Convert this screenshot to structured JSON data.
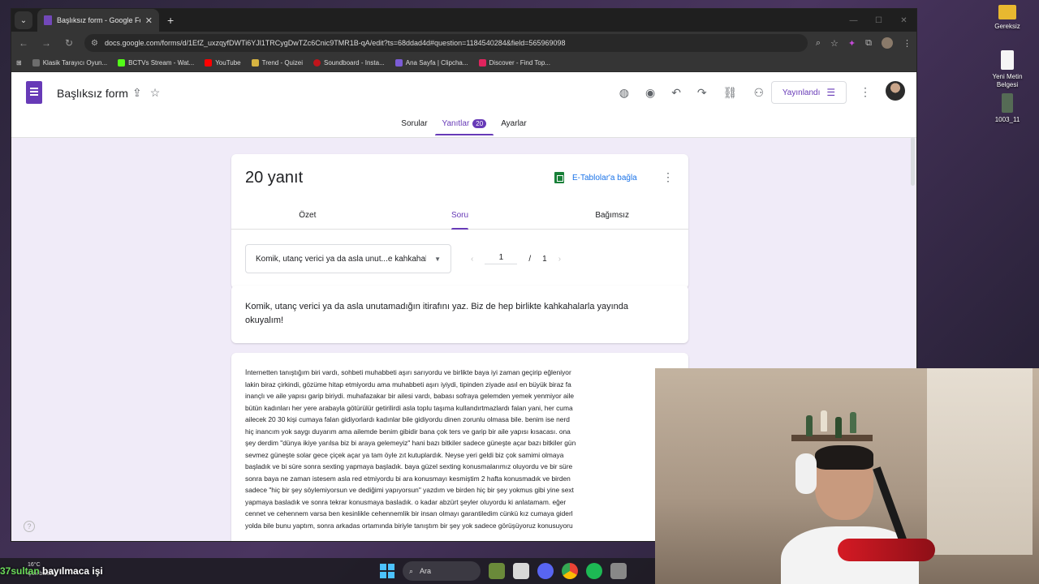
{
  "browser": {
    "tab_title": "Başlıksız form - Google Formlar",
    "url": "docs.google.com/forms/d/1EfZ_uxzqyfDWTi6YJl1TRCygDwTZc6Cnic9TMR1B-qA/edit?ts=68ddad4d#question=1184540284&field=565969098",
    "bookmarks": [
      {
        "label": "Klasik Tarayıcı Oyun...",
        "color": "#6d6d6d"
      },
      {
        "label": "BCTVs Stream - Wat...",
        "color": "#53fc18"
      },
      {
        "label": "YouTube",
        "color": "#ff0000"
      },
      {
        "label": "Trend - Quizei",
        "color": "#d6b341"
      },
      {
        "label": "Soundboard - Insta...",
        "color": "#c0141b"
      },
      {
        "label": "Ana Sayfa | Clipcha...",
        "color": "#7b5cd6"
      },
      {
        "label": "Discover - Find Top...",
        "color": "#e0245e"
      }
    ]
  },
  "form": {
    "title": "Başlıksız form",
    "publish_label": "Yayınlandı",
    "tabs": [
      {
        "label": "Sorular",
        "active": false
      },
      {
        "label": "Yanıtlar",
        "active": true,
        "badge": "20"
      },
      {
        "label": "Ayarlar",
        "active": false
      }
    ]
  },
  "responses": {
    "count_label": "20 yanıt",
    "sheets_link": "E-Tablolar'a bağla",
    "sub_tabs": [
      {
        "label": "Özet",
        "active": false
      },
      {
        "label": "Soru",
        "active": true
      },
      {
        "label": "Bağımsız",
        "active": false
      }
    ],
    "question_select": "Komik, utanç verici ya da asla unut...e kahkahalarla yayında okuyalım!",
    "pager": {
      "current": "1",
      "separator": "/",
      "total": "1"
    }
  },
  "question": {
    "text": "Komik, utanç verici ya da asla unutamadığın itirafını yaz. Biz de hep birlikte kahkahalarla yayında okuyalım!"
  },
  "answer": {
    "lines": [
      "İnternetten tanıştığım biri vardı, sohbeti muhabbeti aşırı sarıyordu ve birlikte baya iyi zaman geçirip eğleniyor",
      "lakin biraz çirkindi, gözüme hitap etmiyordu ama muhabbeti aşırı iyiydi, tipinden ziyade asıl en büyük biraz fa",
      "inançlı ve aile yapısı garip biriydi. muhafazakar bir ailesi vardı, babası sofraya gelemden yemek yenmiyor aile",
      "bütün kadınları her yere arabayla götürülür getirilirdi asla toplu taşıma kullandırtmazlardı falan yani, her cuma",
      "ailecek 20 30 kişi cumaya falan gidiyorlardı kadınlar bile gidiyordu dinen zorunlu olmasa bile. benim ise nerd",
      "hiç inancım yok saygı duyarım ama ailemde benim gibidir bana çok ters ve garip bir aile yapısı kısacası. ona",
      "şey derdim \"dünya ikiye yarılsa biz bi araya gelemeyiz\" hani bazı bitkiler sadece güneşte açar bazı bitkiler gün",
      "sevmez güneşte solar gece çiçek açar ya tam öyle zıt kutuplardık. Neyse yeri geldi biz çok samimi olmaya",
      "başladık ve bi süre sonra sexting yapmaya başladık. baya güzel sexting konusmalarımız oluyordu ve bir süre",
      "sonra baya ne zaman istesem asla red etmiyordu bi ara konusmayı kesmiştim 2 hafta konusmadık ve birden",
      "sadece \"hiç bir şey söylemiyorsun ve dediğimi yapıyorsun\" yazdım ve birden hiç bir şey yokmus gibi yine sext",
      "yapmaya basladık ve sonra tekrar konusmaya basladık. o kadar abzürt şeyler oluyordu ki anlatamam. eğer",
      "cennet ve cehennem varsa ben kesinlikle cehennemlik bir insan olmayı garantiledim cünkü kız cumaya giderl",
      "yolda bile bunu yaptım, sonra arkadas ortamında biriyle tanıştım bir şey yok sadece görüşüyoruz konusuyoru"
    ]
  },
  "desktop": {
    "icons": [
      {
        "label": "Gereksiz",
        "color": "#e8b830"
      },
      {
        "label": "Yeni Metin Belgesi",
        "color": "#f5f5f5"
      },
      {
        "label": "1003_11",
        "color": "#556b55"
      }
    ]
  },
  "taskbar": {
    "temp": "16°C",
    "weather": "Çok bulutlu",
    "overlay_prefix": "37sultan",
    "overlay_text": "bayılmaca işi",
    "search_label": "Ara"
  }
}
